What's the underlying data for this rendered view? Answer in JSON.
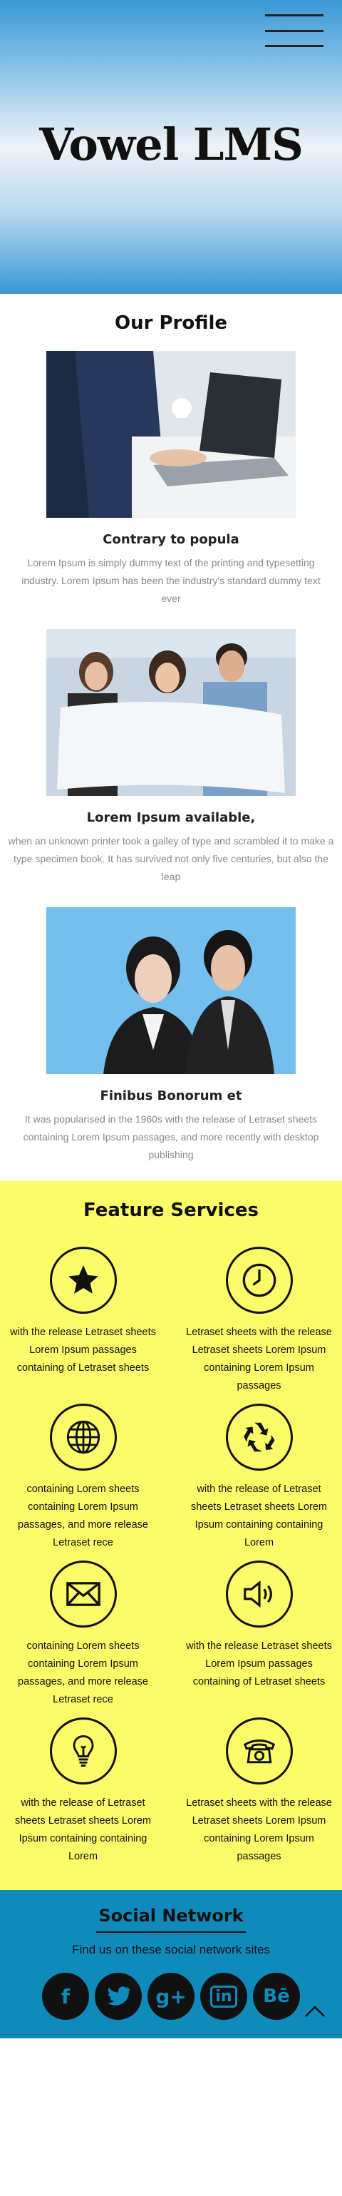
{
  "hero": {
    "title": "Vowel LMS"
  },
  "profile": {
    "title": "Our Profile",
    "cards": [
      {
        "title": "Contrary to popula",
        "text": "Lorem Ipsum is simply dummy text of the printing and typesetting industry. Lorem Ipsum has been the industry's standard dummy text ever"
      },
      {
        "title": "Lorem Ipsum available,",
        "text": "when an unknown printer took a galley of type and scrambled it to make a type specimen book. It has survived not only five centuries, but also the leap"
      },
      {
        "title": "Finibus Bonorum et",
        "text": "It was popularised in the 1960s with the release of Letraset sheets containing Lorem Ipsum passages, and more recently with desktop publishing"
      }
    ]
  },
  "features": {
    "title": "Feature Services",
    "items": [
      {
        "icon": "star-icon",
        "text": "with the release Letraset sheets Lorem Ipsum passages containing of Letraset sheets"
      },
      {
        "icon": "clock-icon",
        "text": "Letraset sheets with the release Letraset sheets Lorem Ipsum containing Lorem Ipsum passages"
      },
      {
        "icon": "globe-icon",
        "text": "containing Lorem sheets containing Lorem Ipsum passages, and more release Letraset rece"
      },
      {
        "icon": "recycle-icon",
        "text": "with the release of Letraset sheets Letraset sheets Lorem Ipsum containing containing Lorem"
      },
      {
        "icon": "mail-icon",
        "text": "containing Lorem sheets containing Lorem Ipsum passages, and more release Letraset rece"
      },
      {
        "icon": "speaker-icon",
        "text": "with the release Letraset sheets Lorem Ipsum passages containing of Letraset sheets"
      },
      {
        "icon": "lightbulb-icon",
        "text": "with the release of Letraset sheets Letraset sheets Lorem Ipsum containing containing Lorem"
      },
      {
        "icon": "phone-icon",
        "text": "Letraset sheets with the release Letraset sheets Lorem Ipsum containing Lorem Ipsum passages"
      }
    ]
  },
  "social": {
    "title": "Social Network",
    "subtitle": "Find us on these social network sites",
    "links": [
      {
        "name": "facebook-icon",
        "glyph": "f"
      },
      {
        "name": "twitter-icon",
        "glyph": ""
      },
      {
        "name": "google-plus-icon",
        "glyph": "g+"
      },
      {
        "name": "linkedin-icon",
        "glyph": "in"
      },
      {
        "name": "behance-icon",
        "glyph": "Bē"
      }
    ]
  },
  "colors": {
    "hero_blue": "#3a98d6",
    "feature_bg": "#fafc68",
    "social_bg": "#0f8bbb",
    "text_gray": "#8a8a8a"
  }
}
